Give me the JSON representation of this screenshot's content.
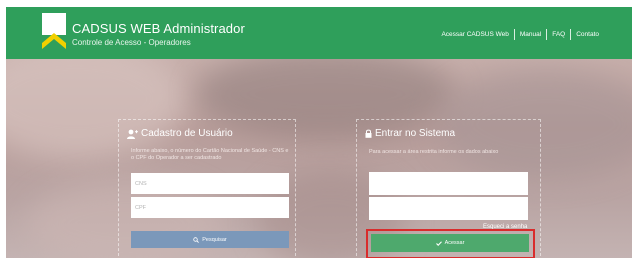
{
  "header": {
    "title": "CADSUS WEB Administrador",
    "subtitle": "Controle de Acesso - Operadores",
    "nav": [
      "Acessar CADSUS Web",
      "Manual",
      "FAQ",
      "Contato"
    ]
  },
  "register": {
    "title": "Cadastro de Usuário",
    "description": "Informe abaixo, o número do Cartão Nacional de Saúde - CNS e o CPF do Operador a ser cadastrado",
    "cns_placeholder": "CNS",
    "cpf_placeholder": "CPF",
    "search_label": "Pesquisar",
    "icon": "user-add-icon"
  },
  "login": {
    "title": "Entrar no Sistema",
    "description": "Para acessar a área restrita informe os dados abaixo",
    "username_value": "",
    "password_value": "",
    "forgot_label": "Esqueci a senha",
    "submit_label": "Acessar",
    "icon": "lock-icon"
  },
  "colors": {
    "header": "#2f9f5b",
    "login_button": "#4ea96d",
    "search_button": "#7b98ba",
    "highlight": "#d92c2c"
  }
}
